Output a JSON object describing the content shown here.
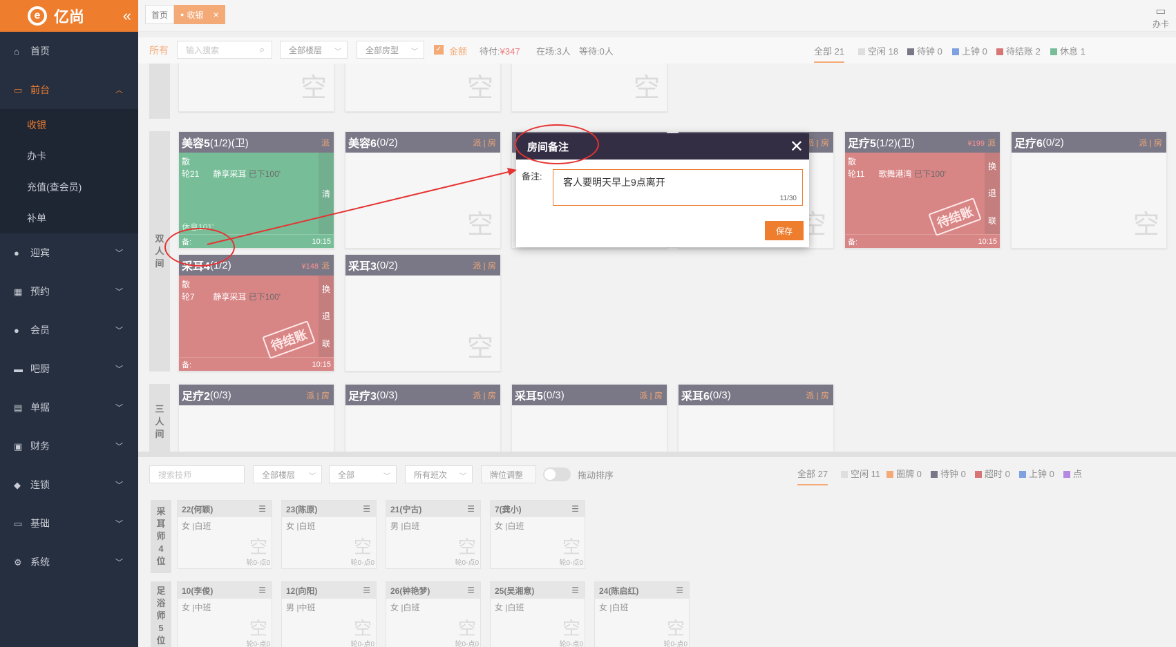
{
  "sidebar": {
    "brand": "亿尚",
    "collapse": "«",
    "items": [
      {
        "label": "首页",
        "icon": "home-icon"
      },
      {
        "label": "前台",
        "icon": "monitor-icon"
      },
      {
        "label": "迎宾",
        "icon": "user-icon"
      },
      {
        "label": "预约",
        "icon": "calendar-icon"
      },
      {
        "label": "会员",
        "icon": "member-icon"
      },
      {
        "label": "吧厨",
        "icon": "cup-icon"
      },
      {
        "label": "单据",
        "icon": "document-icon"
      },
      {
        "label": "财务",
        "icon": "finance-icon"
      },
      {
        "label": "连锁",
        "icon": "cube-icon"
      },
      {
        "label": "基础",
        "icon": "base-icon"
      },
      {
        "label": "系统",
        "icon": "gear-icon"
      }
    ],
    "sub": [
      "收银",
      "办卡",
      "充值(查会员)",
      "补单"
    ]
  },
  "tabs": {
    "home": "首页",
    "cashier": "收银",
    "close": "×"
  },
  "topbar": {
    "card": "办卡"
  },
  "filter": {
    "all": "所有",
    "search_placeholder": "输入搜索",
    "floor": "全部楼层",
    "roomtype": "全部房型",
    "amount": "金额",
    "pending_label": "待付:",
    "pending": "¥347",
    "onsite": "在场:3人",
    "waiting": "等待:0人",
    "stats": [
      "全部 21",
      "空闲 18",
      "待钟 0",
      "上钟 0",
      "待结账 2",
      "休息 1"
    ]
  },
  "groups": {
    "double": "双人间",
    "triple": "三人间"
  },
  "empty": "空",
  "actions": "派 | 房",
  "act_pai": "派",
  "rooms": [
    {
      "name": "美容5",
      "count": "(1/2)(卫)",
      "type": "散",
      "wheel": "轮21",
      "service": "静享采耳",
      "status": "已下100'",
      "side": "清",
      "rest": "休息101'",
      "note": "备:",
      "time": "10:15"
    },
    {
      "name": "美容6",
      "count": "(0/2)"
    },
    {
      "name": "采耳4",
      "count": "(1/2)",
      "price": "¥148",
      "type": "散",
      "wheel": "轮7",
      "service": "静享采耳",
      "status": "已下100'",
      "side": [
        "换",
        "退",
        "联"
      ],
      "stamp": "待结账",
      "note": "备:",
      "time": "10:15"
    },
    {
      "name": "采耳3",
      "count": "(0/2)"
    },
    {
      "name": "足疗5",
      "count": "(1/2)(卫)",
      "price": "¥199",
      "type": "散",
      "wheel": "轮11",
      "service": "歌舞港湾",
      "status": "已下100'",
      "side": [
        "换",
        "退",
        "联"
      ],
      "stamp": "待结账",
      "note": "备:",
      "time": "10:15"
    },
    {
      "name": "足疗6",
      "count": "(0/2)"
    },
    {
      "name": "足疗2",
      "count": "(0/3)"
    },
    {
      "name": "足疗3",
      "count": "(0/3)"
    },
    {
      "name": "采耳5",
      "count": "(0/3)"
    },
    {
      "name": "采耳6",
      "count": "(0/3)"
    }
  ],
  "lower": {
    "search_placeholder": "搜索技师",
    "floor": "全部楼层",
    "all": "全部",
    "shift": "所有班次",
    "adjust": "牌位调整",
    "drag": "拖动排序",
    "stats": [
      "全部 27",
      "空闲 11",
      "圈牌 0",
      "待钟 0",
      "超时 0",
      "上钟 0",
      "点"
    ],
    "groups": {
      "ear": "采耳师4位",
      "foot": "足浴师5位"
    },
    "techs": [
      {
        "name": "22(何颖)",
        "info": "女 |白班",
        "cnt": "轮0-点0"
      },
      {
        "name": "23(陈原)",
        "info": "女 |白班",
        "cnt": "轮0-点0"
      },
      {
        "name": "21(宁古)",
        "info": "男 |白班",
        "cnt": "轮0-点0"
      },
      {
        "name": "7(龚小)",
        "info": "女 |白班",
        "cnt": "轮0-点0"
      },
      {
        "name": "10(李俊)",
        "info": "女 |中班",
        "cnt": "轮0-点0"
      },
      {
        "name": "12(向阳)",
        "info": "男 |中班",
        "cnt": "轮0-点0"
      },
      {
        "name": "26(钟艳梦)",
        "info": "女 |白班",
        "cnt": "轮0-点0"
      },
      {
        "name": "25(吴湘意)",
        "info": "女 |白班",
        "cnt": "轮0-点0"
      },
      {
        "name": "24(陈启红)",
        "info": "女 |白班",
        "cnt": "轮0-点0"
      }
    ]
  },
  "modal": {
    "title": "房间备注",
    "label": "备注:",
    "value": "客人要明天早上9点离开",
    "count": "11/30",
    "save": "保存",
    "close": "✕"
  }
}
